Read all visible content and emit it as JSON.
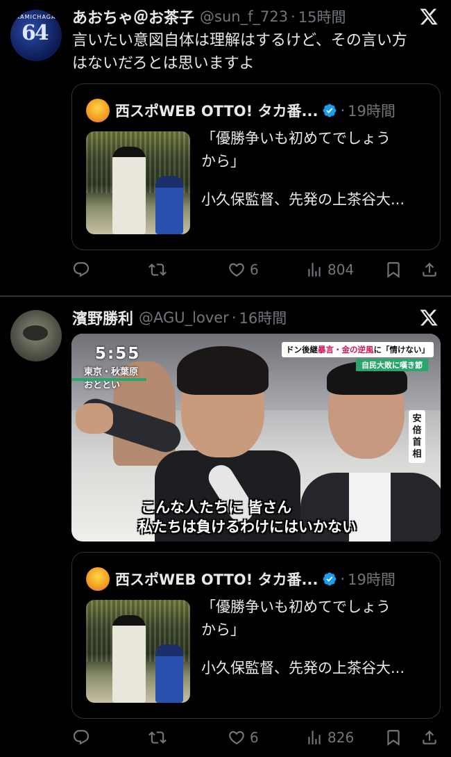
{
  "tweets": [
    {
      "author": {
        "name": "あおちゃ＠お茶子",
        "handle": "@sun_f_723",
        "time": "15時間",
        "avatar_icon": "baseball-jersey-64-avatar"
      },
      "text_lines": [
        "言いたい意図自体は理解はするけど、その言い方",
        "はないだろとは思いますよ"
      ],
      "quote": {
        "name": "西スポWEB OTTO! タカ番...",
        "verified": true,
        "time": "19時間",
        "lines": [
          "「優勝争いも初めてでしょう",
          "から」",
          "小久保監督、先発の上茶谷大..."
        ]
      },
      "actions": {
        "reply": "",
        "retweet": "",
        "like": "6",
        "views": "804"
      }
    },
    {
      "author": {
        "name": "濱野勝利",
        "handle": "@AGU_lover",
        "time": "16時間",
        "avatar_icon": "landscape-photo-avatar"
      },
      "media": {
        "clock": "5:55",
        "location_lines": [
          "東京・秋葉原",
          "おととい"
        ],
        "headline_parts": [
          "ドン後継",
          "暴言・金の逆風",
          "に「情けない」"
        ],
        "sub_headline": "自民大敗に嘆き節",
        "name_tag": [
          "安",
          "倍",
          "首",
          "相"
        ],
        "caption_lines": [
          "こんな人たちに 皆さん",
          "私たちは負けるわけにはいかない"
        ]
      },
      "quote": {
        "name": "西スポWEB OTTO! タカ番...",
        "verified": true,
        "time": "19時間",
        "lines": [
          "「優勝争いも初めてでしょう",
          "から」",
          "小久保監督、先発の上茶谷大..."
        ]
      },
      "actions": {
        "reply": "",
        "retweet": "",
        "like": "6",
        "views": "826"
      }
    }
  ],
  "colors": {
    "background": "#000000",
    "text": "#e7e9ea",
    "muted": "#71767b",
    "border": "#2f3336",
    "verified": "#1d9bf0"
  }
}
